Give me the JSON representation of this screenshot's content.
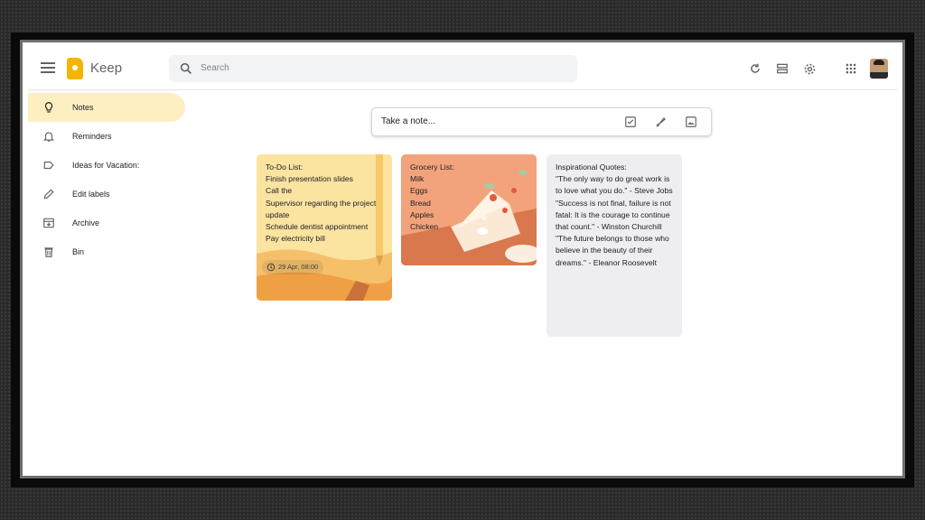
{
  "app": {
    "name": "Keep"
  },
  "search": {
    "placeholder": "Search"
  },
  "sidebar": {
    "items": [
      {
        "label": "Notes",
        "active": true,
        "icon": "lightbulb-icon"
      },
      {
        "label": "Reminders",
        "active": false,
        "icon": "bell-icon"
      },
      {
        "label": "Ideas for Vacation:",
        "active": false,
        "icon": "label-icon"
      },
      {
        "label": "Edit labels",
        "active": false,
        "icon": "pencil-icon"
      },
      {
        "label": "Archive",
        "active": false,
        "icon": "archive-icon"
      },
      {
        "label": "Bin",
        "active": false,
        "icon": "trash-icon"
      }
    ]
  },
  "take_note": {
    "placeholder": "Take a note..."
  },
  "notes": [
    {
      "lines": [
        "To-Do List:",
        "Finish presentation slides",
        "Call the",
        "Supervisor regarding the project",
        "update",
        "Schedule dentist appointment",
        "Pay electricity bill"
      ],
      "reminder": "29 Apr, 08:00",
      "color": "#fbe3a0"
    },
    {
      "lines": [
        "Grocery List:",
        "Milk",
        "Eggs",
        "Bread",
        "Apples",
        "Chicken"
      ],
      "color": "#f3a37c"
    },
    {
      "lines": [
        "Inspirational Quotes:",
        "\"The only way to do great work is to love what you do.\" - Steve Jobs",
        "\"Success is not final, failure is not fatal: It is the courage to continue that count.\" - Winston Churchill",
        "\"The future belongs to those who believe in the beauty of their dreams.\" - Eleanor Roosevelt"
      ],
      "color": "#eeeef0"
    }
  ],
  "colors": {
    "accent": "#f5b400",
    "active_nav": "#feefc3"
  }
}
